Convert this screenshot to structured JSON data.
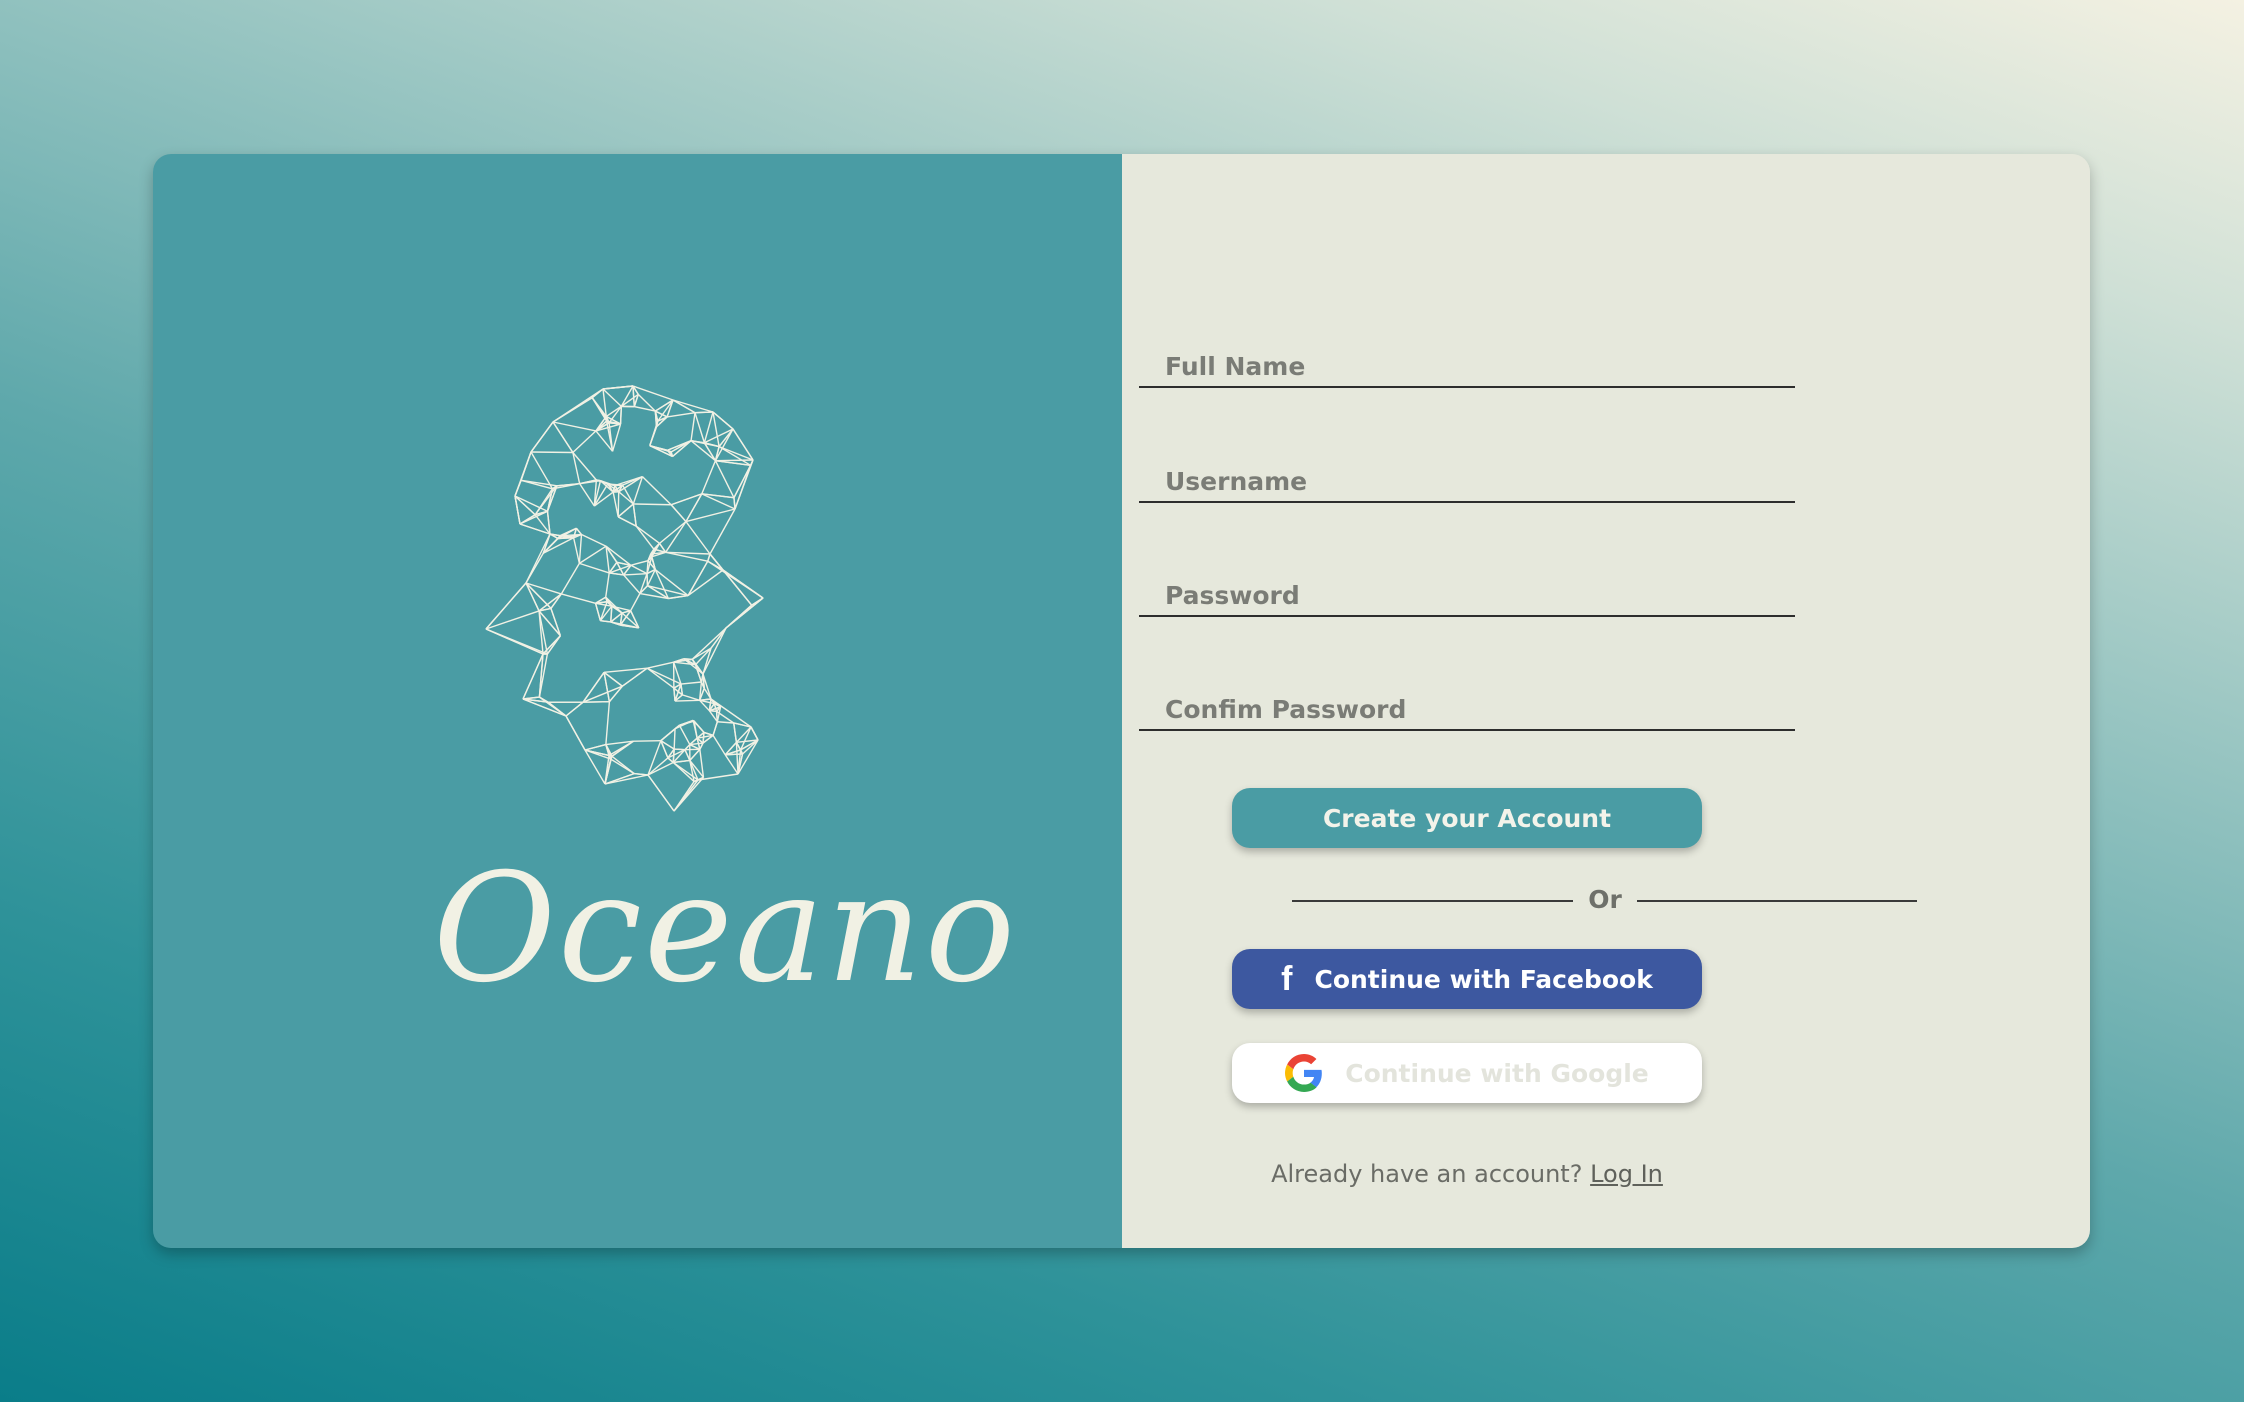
{
  "brand": {
    "name": "Oceano",
    "logo_icon": "polygon-mesh-icon",
    "panel_color": "#4a9ca4"
  },
  "form": {
    "fields": [
      {
        "placeholder": "Full Name",
        "value": ""
      },
      {
        "placeholder": "Username",
        "value": ""
      },
      {
        "placeholder": "Password",
        "value": ""
      },
      {
        "placeholder": "Confim Password",
        "value": ""
      }
    ],
    "create_button_label": "Create your Account",
    "divider_label": "Or",
    "facebook_button_label": "Continue with Facebook",
    "google_button_label": "Continue with Google",
    "facebook_color": "#3d58a0",
    "accent_color": "#4a9ca4"
  },
  "footer": {
    "prompt": "Already have an account?",
    "login_label": "Log In"
  }
}
